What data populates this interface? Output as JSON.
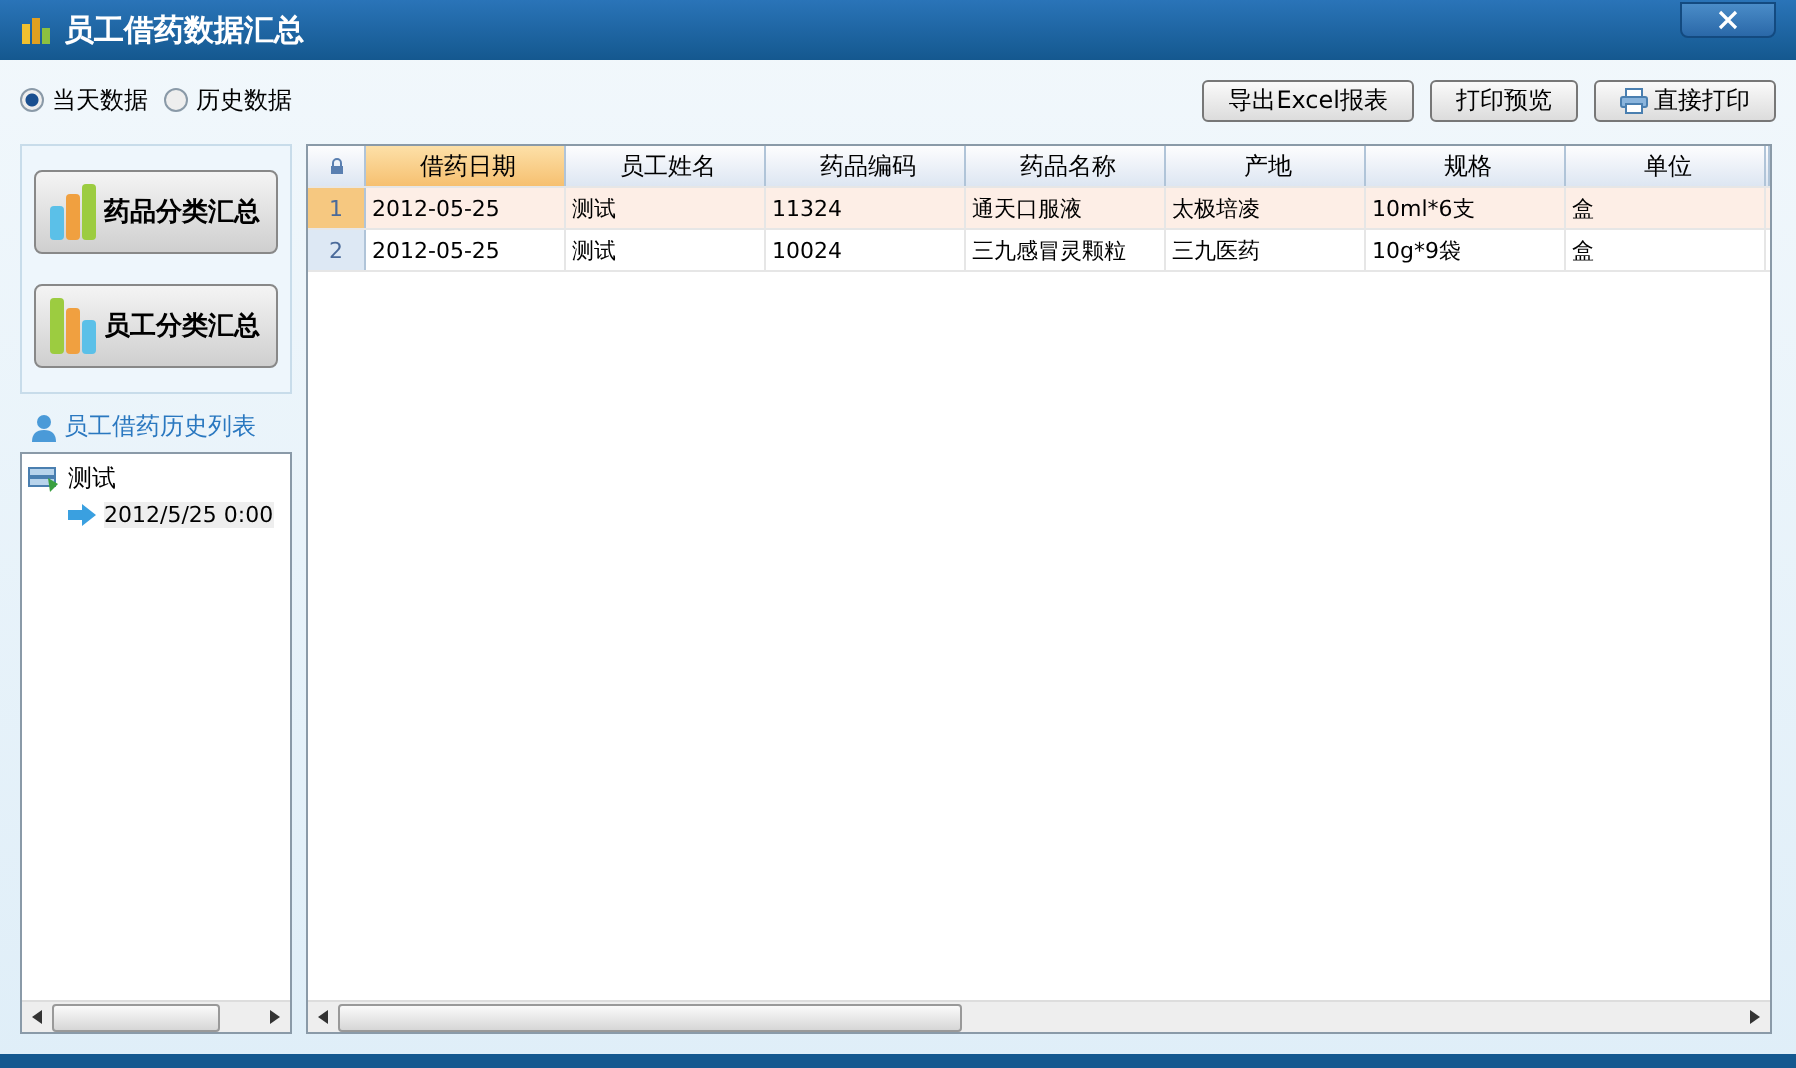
{
  "window": {
    "title": "员工借药数据汇总"
  },
  "data_range": [
    {
      "label": "当天数据",
      "selected": true
    },
    {
      "label": "历史数据",
      "selected": false
    }
  ],
  "toolbar_buttons": [
    {
      "label": "导出Excel报表",
      "kind": "text"
    },
    {
      "label": "打印预览",
      "kind": "text"
    },
    {
      "label": "直接打印",
      "kind": "printer"
    }
  ],
  "sidebar": {
    "buttons": [
      {
        "label": "药品分类汇总",
        "kind": "medicine"
      },
      {
        "label": "员工分类汇总",
        "kind": "employee"
      }
    ],
    "history_title": "员工借药历史列表",
    "tree": [
      {
        "label": "测试",
        "expanded": true,
        "children": [
          {
            "label": "2012/5/25 0:00"
          }
        ]
      }
    ]
  },
  "table": {
    "columns": [
      {
        "label": "借药日期",
        "selected": true
      },
      {
        "label": "员工姓名",
        "selected": false
      },
      {
        "label": "药品编码",
        "selected": false
      },
      {
        "label": "药品名称",
        "selected": false
      },
      {
        "label": "产地",
        "selected": false
      },
      {
        "label": "规格",
        "selected": false
      },
      {
        "label": "单位",
        "selected": false
      }
    ],
    "rows": [
      {
        "index": "1",
        "selected": true,
        "cells": [
          "2012-05-25",
          "测试",
          "11324",
          "通天口服液",
          "太极培凌",
          "10ml*6支",
          "盒"
        ]
      },
      {
        "index": "2",
        "selected": false,
        "cells": [
          "2012-05-25",
          "测试",
          "10024",
          "三九感冒灵颗粒",
          "三九医药",
          "10g*9袋",
          "盒"
        ]
      }
    ]
  }
}
